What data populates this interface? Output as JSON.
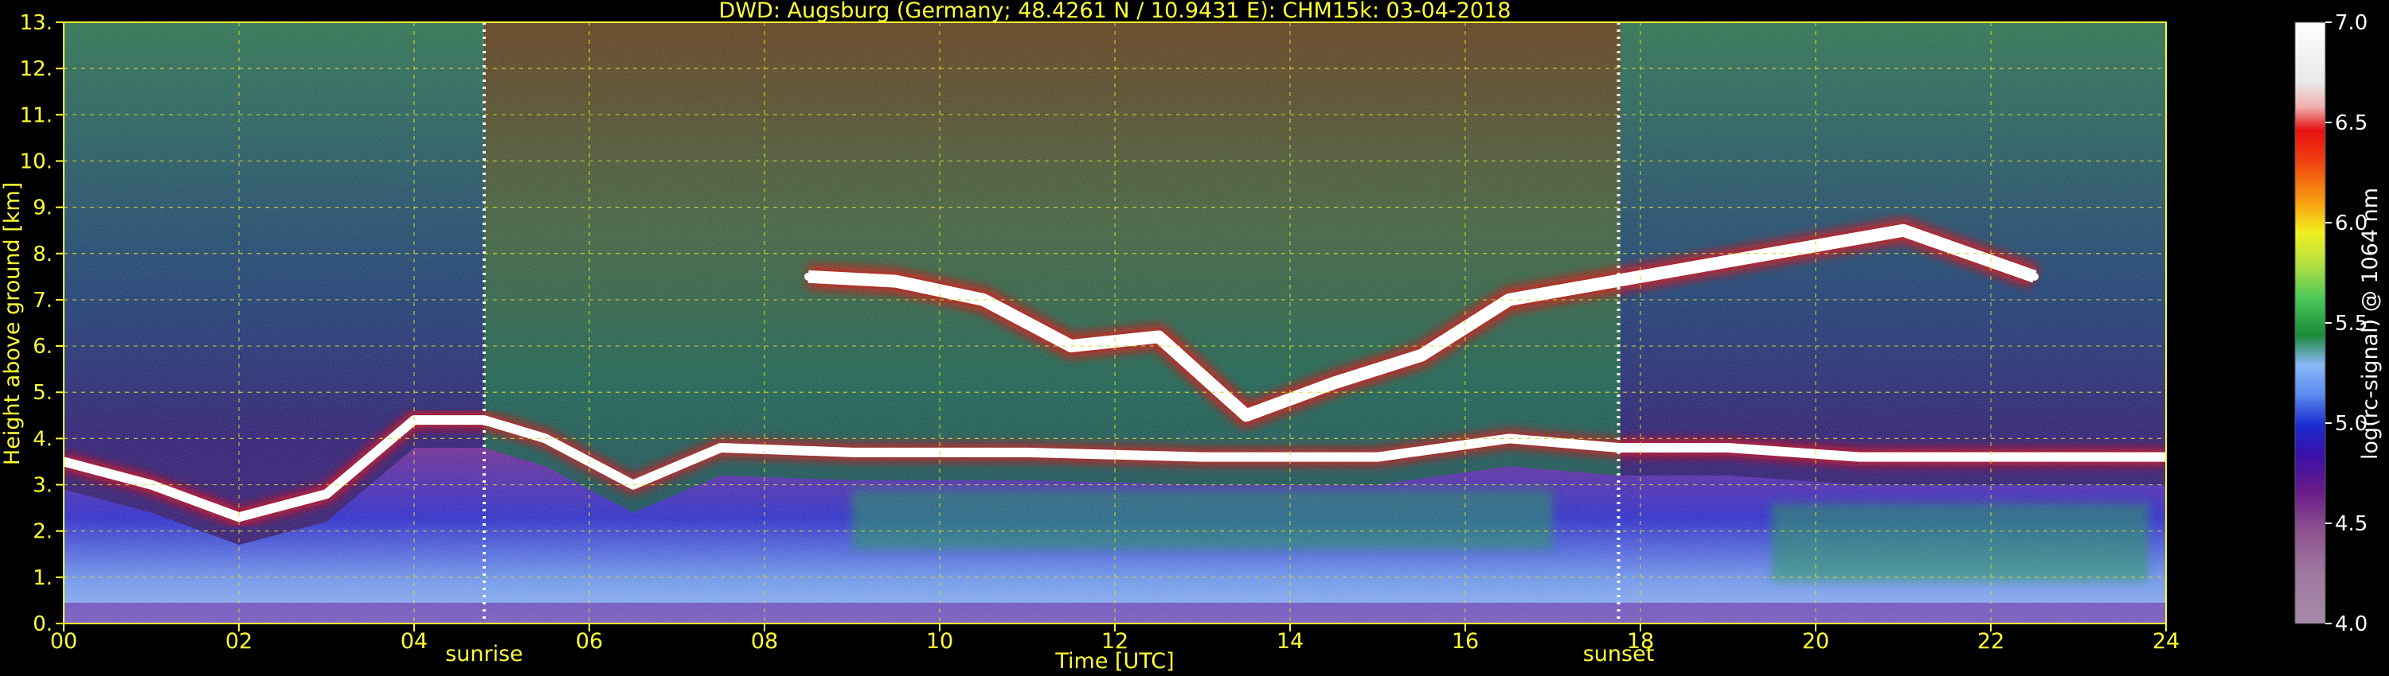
{
  "chart_data": {
    "type": "heatmap",
    "title": "DWD: Augsburg (Germany; 48.4261 N / 10.9431 E):    CHM15k: 03-04-2018",
    "xlabel": "Time [UTC]",
    "ylabel": "Height above ground [km]",
    "xlim": [
      0,
      24
    ],
    "ylim": [
      0,
      13
    ],
    "x_ticks": [
      "00",
      "02",
      "04",
      "06",
      "08",
      "10",
      "12",
      "14",
      "16",
      "18",
      "20",
      "22",
      "24"
    ],
    "y_ticks": [
      "0.",
      "1.",
      "2.",
      "3.",
      "4.",
      "5.",
      "6.",
      "7.",
      "8.",
      "9.",
      "10.",
      "11.",
      "12.",
      "13."
    ],
    "grid": true,
    "markers": [
      {
        "label": "sunrise",
        "x": 4.8
      },
      {
        "label": "sunset",
        "x": 17.75
      }
    ],
    "colorbar": {
      "label": "log(rc-signal) @ 1064 nm",
      "range": [
        4.0,
        7.0
      ],
      "ticks": [
        "4.0",
        "4.5",
        "5.0",
        "5.5",
        "6.0",
        "6.5",
        "7.0"
      ],
      "colors": [
        "#a58aa8",
        "#a07aa0",
        "#8a4f8e",
        "#7a2a8a",
        "#5a1590",
        "#3a10a8",
        "#1a2ad0",
        "#3a6af0",
        "#6a9af8",
        "#8ab8f8",
        "#1a8a3a",
        "#2aaa4a",
        "#4ac85a",
        "#7ad070",
        "#b8e040",
        "#e8f020",
        "#f8d010",
        "#f89810",
        "#f86010",
        "#f03018",
        "#e81010",
        "#f0b0b0",
        "#e8e8e8",
        "#ffffff"
      ]
    },
    "features": [
      {
        "name": "boundary layer top",
        "x": [
          0,
          1,
          2,
          3,
          4,
          4.8,
          5.5,
          6.5,
          7.5,
          9,
          11,
          13,
          15,
          16.5,
          17.75,
          19,
          20.5,
          22,
          24
        ],
        "y": [
          3.5,
          3.0,
          2.3,
          2.8,
          4.4,
          4.4,
          4.0,
          3.0,
          3.8,
          3.7,
          3.7,
          3.6,
          3.6,
          4.0,
          3.8,
          3.8,
          3.6,
          3.6,
          3.6
        ]
      },
      {
        "name": "cirrus layer",
        "x": [
          8.5,
          9.5,
          10.5,
          11.5,
          12.5,
          13.5,
          14.5,
          15.5,
          16.5,
          21,
          22.5
        ],
        "y": [
          7.5,
          7.4,
          7.0,
          6.0,
          6.2,
          4.5,
          5.2,
          5.8,
          7.0,
          8.5,
          7.5
        ]
      }
    ]
  }
}
